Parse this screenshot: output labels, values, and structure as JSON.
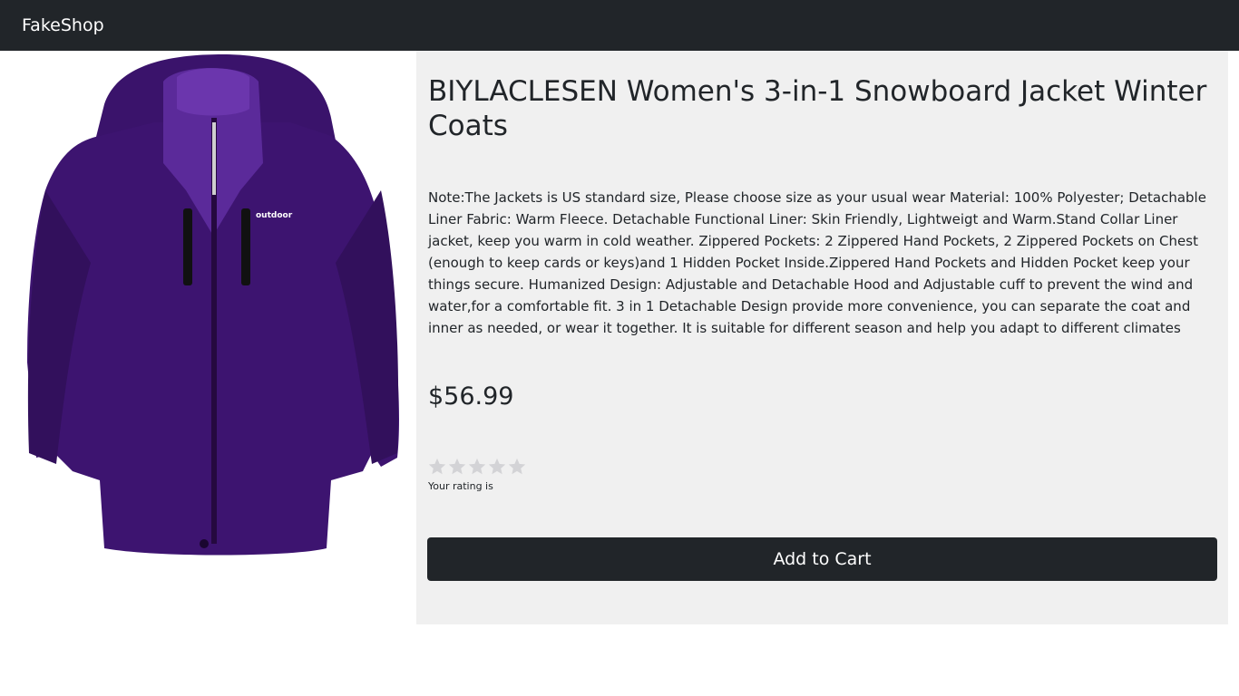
{
  "navbar": {
    "brand": "FakeShop"
  },
  "product": {
    "image_icon": "purple-jacket-image",
    "jacket_logo": "outdoor",
    "title": "BIYLACLESEN Women's 3-in-1 Snowboard Jacket Winter Coats",
    "description": "Note:The Jackets is US standard size, Please choose size as your usual wear Material: 100% Polyester; Detachable Liner Fabric: Warm Fleece. Detachable Functional Liner: Skin Friendly, Lightweigt and Warm.Stand Collar Liner jacket, keep you warm in cold weather. Zippered Pockets: 2 Zippered Hand Pockets, 2 Zippered Pockets on Chest (enough to keep cards or keys)and 1 Hidden Pocket Inside.Zippered Hand Pockets and Hidden Pocket keep your things secure. Humanized Design: Adjustable and Detachable Hood and Adjustable cuff to prevent the wind and water,for a comfortable fit. 3 in 1 Detachable Design provide more convenience, you can separate the coat and inner as needed, or wear it together. It is suitable for different season and help you adapt to different climates",
    "price": "$56.99",
    "rating": {
      "value": 0,
      "max": 5,
      "label": "Your rating is",
      "star_icon": "star-icon",
      "empty_color": "#d3d3d6"
    },
    "add_to_cart_label": "Add to Cart"
  },
  "colors": {
    "navbar_bg": "#212529",
    "panel_bg": "#f0f0f0",
    "jacket_purple": "#3d1470",
    "button_bg": "#212529"
  }
}
